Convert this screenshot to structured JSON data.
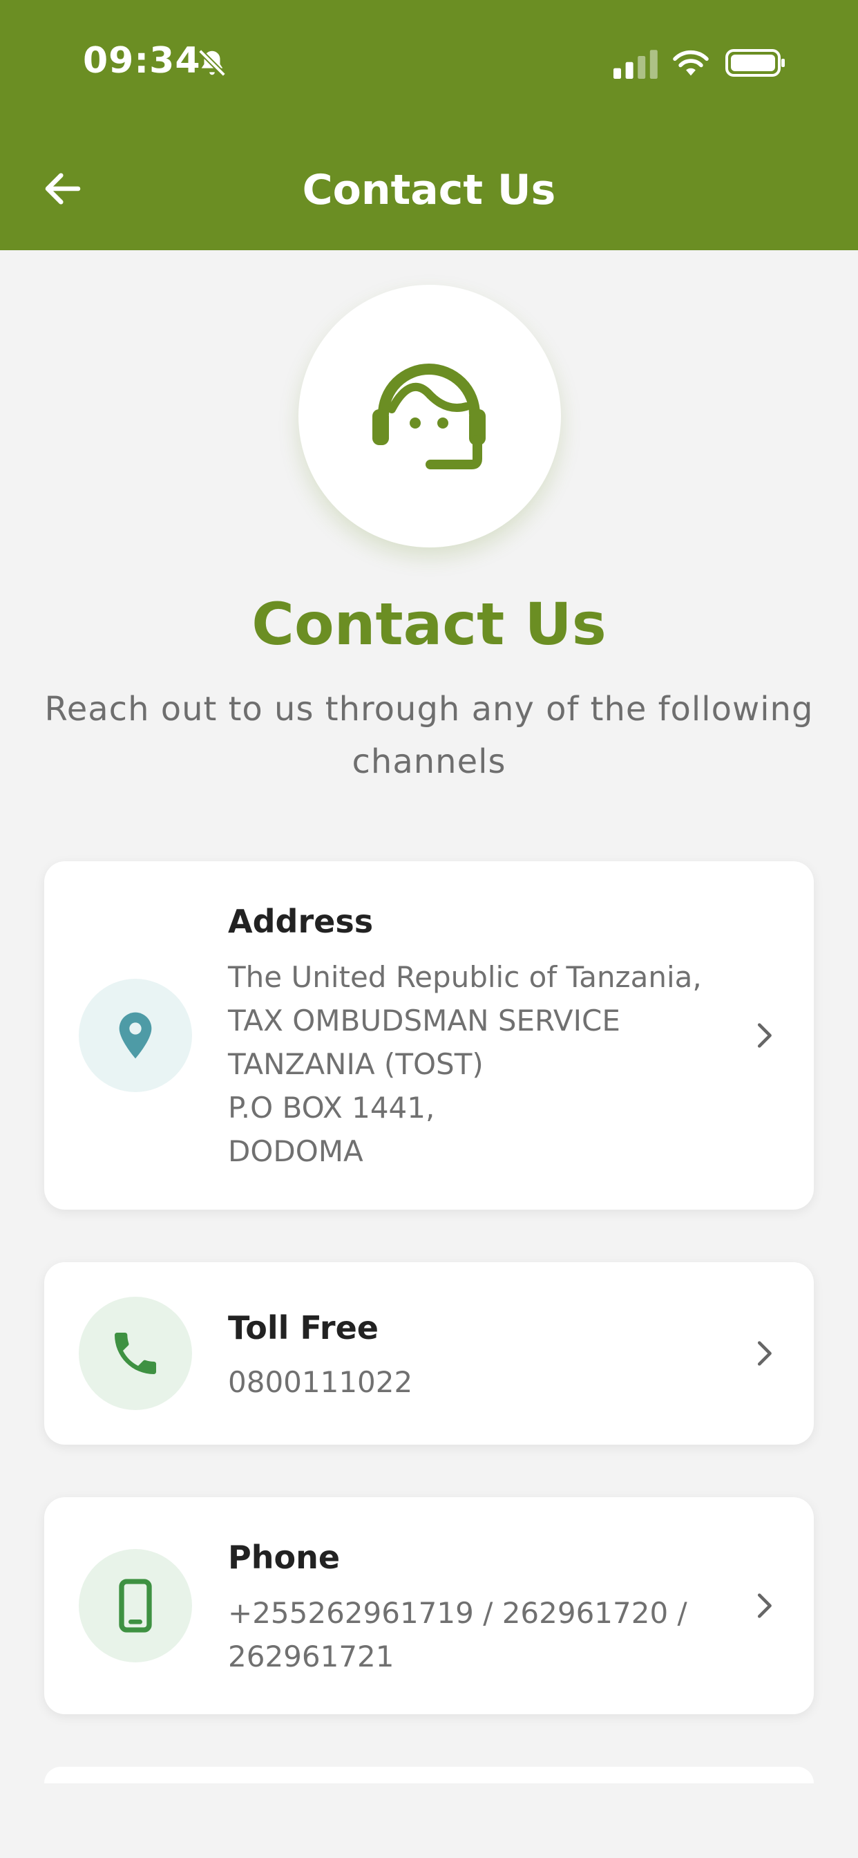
{
  "status_bar": {
    "time": "09:34"
  },
  "header": {
    "title": "Contact Us"
  },
  "hero": {
    "title": "Contact Us",
    "subtitle": "Reach out to us through any of the following channels"
  },
  "cards": [
    {
      "label": "Address",
      "lines": [
        "The United Republic of Tanzania,",
        "TAX OMBUDSMAN SERVICE",
        "TANZANIA (TOST)",
        "P.O BOX 1441,",
        "DODOMA"
      ],
      "icon": "location-pin-icon"
    },
    {
      "label": "Toll Free",
      "lines": [
        "0800111022"
      ],
      "icon": "phone-handset-icon"
    },
    {
      "label": "Phone",
      "lines": [
        "+255262961719 / 262961720 /",
        "262961721"
      ],
      "icon": "mobile-phone-icon"
    }
  ],
  "colors": {
    "brand_green": "#6b8e23",
    "teal": "#4e9ba6",
    "phone_green": "#3e9142",
    "background": "#f3f3f3"
  }
}
